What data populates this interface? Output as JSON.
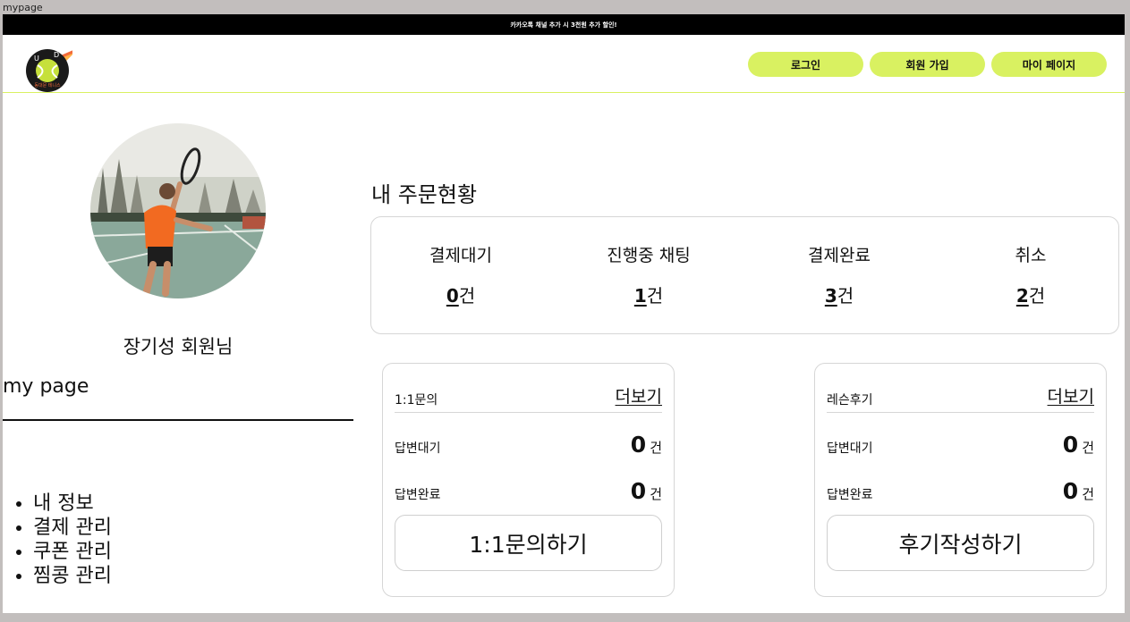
{
  "window": {
    "title": "mypage"
  },
  "banner": {
    "text": "카카오톡 채널 추가 시 3천원 추가 할인!"
  },
  "header": {
    "logo": {
      "letters": [
        "U",
        "D"
      ],
      "caption": "동대문 테니스"
    },
    "buttons": {
      "login": "로그인",
      "signup": "회원 가입",
      "mypage": "마이 페이지"
    }
  },
  "colors": {
    "accent": "#d9f161",
    "topbar": "#000000"
  },
  "profile": {
    "image": "tennis-player-photo",
    "name": "장기성 회원님"
  },
  "sidebar": {
    "title": "my page",
    "items": [
      "내 정보",
      "결제 관리",
      "쿠폰 관리",
      "찜콩 관리"
    ]
  },
  "orders": {
    "title": "내 주문현황",
    "statuses": [
      {
        "label": "결제대기",
        "count": "0",
        "unit": "건"
      },
      {
        "label": "진행중 채팅",
        "count": "1",
        "unit": "건"
      },
      {
        "label": "결제완료",
        "count": "3",
        "unit": "건"
      },
      {
        "label": "취소",
        "count": "2",
        "unit": "건"
      }
    ]
  },
  "inquiry": {
    "title": "1:1문의",
    "more": "더보기",
    "rows": [
      {
        "label": "답변대기",
        "count": "0",
        "unit": "건"
      },
      {
        "label": "답변완료",
        "count": "0",
        "unit": "건"
      }
    ],
    "button": "1:1문의하기"
  },
  "review": {
    "title": "레슨후기",
    "more": "더보기",
    "rows": [
      {
        "label": "답변대기",
        "count": "0",
        "unit": "건"
      },
      {
        "label": "답변완료",
        "count": "0",
        "unit": "건"
      }
    ],
    "button": "후기작성하기"
  }
}
